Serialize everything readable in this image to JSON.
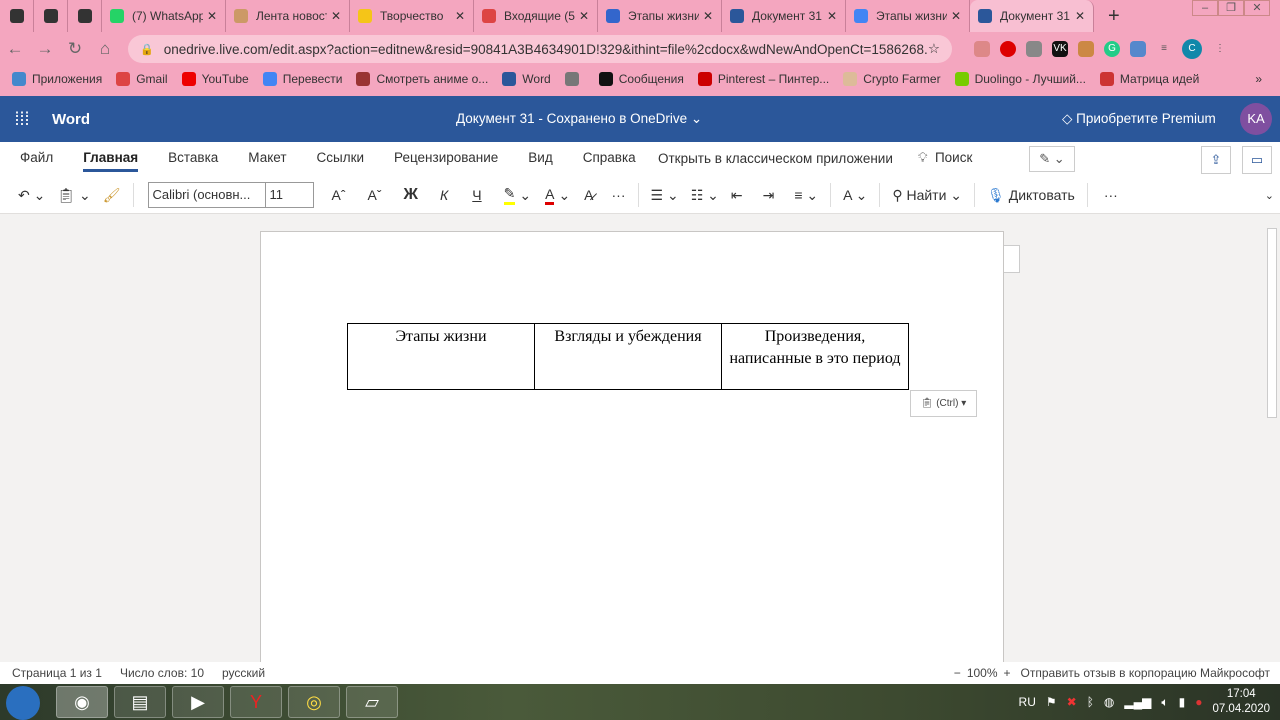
{
  "browser": {
    "tabs": [
      {
        "label": "",
        "icon": "speaker-icon"
      },
      {
        "label": "",
        "icon": "message-icon"
      },
      {
        "label": "",
        "icon": "mail-icon"
      },
      {
        "label": "(7) WhatsApp",
        "icon": "whatsapp-icon",
        "color": "#25d366"
      },
      {
        "label": "Лента новостей",
        "icon": "feed-icon",
        "color": "#c96"
      },
      {
        "label": "Творчество",
        "icon": "play-icon",
        "color": "#f5c518"
      },
      {
        "label": "Входящие (5",
        "icon": "gmail-icon",
        "color": "#d44"
      },
      {
        "label": "Этапы жизни",
        "icon": "s-icon",
        "color": "#36c"
      },
      {
        "label": "Документ 31",
        "icon": "word-icon",
        "color": "#2b579a"
      },
      {
        "label": "Этапы жизни",
        "icon": "google-icon",
        "color": "#4285f4"
      },
      {
        "label": "Документ 31",
        "icon": "word-icon",
        "color": "#2b579a",
        "active": true
      }
    ],
    "url": "onedrive.live.com/edit.aspx?action=editnew&resid=90841A3B4634901D!329&ithint=file%2cdocx&wdNewAndOpenCt=1586268...",
    "profile": "C",
    "bookmarks": [
      {
        "label": "Приложения",
        "color": "#48c"
      },
      {
        "label": "Gmail",
        "color": "#d44"
      },
      {
        "label": "YouTube",
        "color": "#e00"
      },
      {
        "label": "Перевести",
        "color": "#4285f4"
      },
      {
        "label": "Смотреть аниме о...",
        "color": "#933"
      },
      {
        "label": "Word",
        "color": "#2b579a"
      },
      {
        "label": "",
        "color": "#777"
      },
      {
        "label": "Сообщения",
        "color": "#111"
      },
      {
        "label": "Pinterest – Пинтер...",
        "color": "#c00"
      },
      {
        "label": "Crypto Farmer",
        "color": "#db9"
      },
      {
        "label": "Duolingo - Лучший...",
        "color": "#7c0"
      },
      {
        "label": "Матрица идей",
        "color": "#c33"
      }
    ]
  },
  "word": {
    "app": "Word",
    "title": "Документ 31  -  Сохранено в OneDrive",
    "premium": "Приобретите Premium",
    "avatar": "KA",
    "menu": [
      "Файл",
      "Главная",
      "Вставка",
      "Макет",
      "Ссылки",
      "Рецензирование",
      "Вид",
      "Справка"
    ],
    "active_menu": "Главная",
    "open_app": "Открыть в классическом приложении",
    "search": "Поиск",
    "font": "Calibri (основн...",
    "size": "11",
    "bold": "Ж",
    "italic": "К",
    "underline": "Ч",
    "find": "Найти",
    "dictate": "Диктовать",
    "accent": "#2b579a"
  },
  "document": {
    "table": [
      "Этапы жизни",
      "Взгляды и убеждения",
      "Произведения, написанные в это период"
    ],
    "paste_label": "(Ctrl)"
  },
  "status": {
    "page": "Страница 1 из 1",
    "words": "Число слов: 10",
    "lang": "русский",
    "zoom": "100%",
    "feedback": "Отправить отзыв в корпорацию Майкрософт"
  },
  "taskbar": {
    "lang": "RU",
    "time": "17:04",
    "date": "07.04.2020"
  }
}
